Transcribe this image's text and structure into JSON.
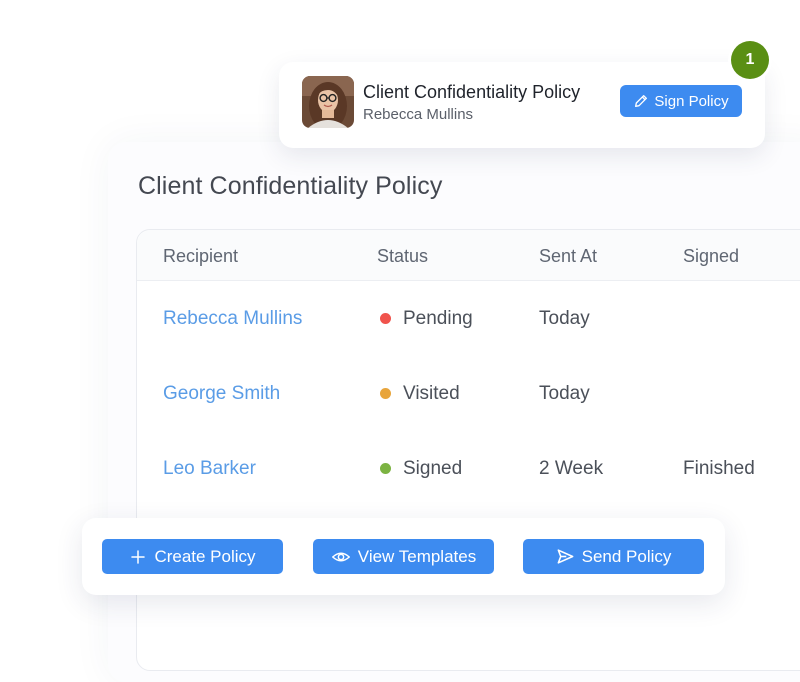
{
  "notification": {
    "title": "Client Confidentiality Policy",
    "recipient": "Rebecca Mullins",
    "sign_button": "Sign Policy",
    "step_badge": "1"
  },
  "panel": {
    "title": "Client Confidentiality Policy"
  },
  "table": {
    "columns": [
      "Recipient",
      "Status",
      "Sent At",
      "Signed"
    ],
    "rows": [
      {
        "recipient": "Rebecca Mullins",
        "status": "Pending",
        "status_color": "#f0534c",
        "sent_at": "Today",
        "signed": ""
      },
      {
        "recipient": "George Smith",
        "status": "Visited",
        "status_color": "#e8a53c",
        "sent_at": "Today",
        "signed": ""
      },
      {
        "recipient": "Leo Barker",
        "status": "Signed",
        "status_color": "#7cb342",
        "sent_at": "2 Week",
        "signed": "Finished"
      }
    ]
  },
  "actions": {
    "create": "Create Policy",
    "view_templates": "View Templates",
    "send": "Send Policy"
  },
  "colors": {
    "accent": "#3d8bf0",
    "link": "#5a9ce6",
    "badge": "#5a8f14"
  },
  "icons": {
    "sign": "pencil-icon",
    "create": "plus-icon",
    "view_templates": "eye-icon",
    "send": "send-icon"
  }
}
